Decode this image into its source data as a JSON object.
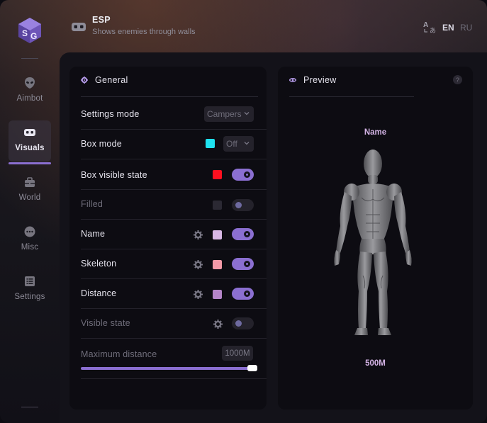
{
  "sidebar": {
    "logo": "sg-cube-logo",
    "items": [
      {
        "label": "Aimbot",
        "icon": "alien-icon"
      },
      {
        "label": "Visuals",
        "icon": "vr-headset-icon",
        "active": true
      },
      {
        "label": "World",
        "icon": "briefcase-icon"
      },
      {
        "label": "Misc",
        "icon": "dots-circle-icon"
      },
      {
        "label": "Settings",
        "icon": "list-icon"
      }
    ]
  },
  "header": {
    "icon": "vr-headset-icon",
    "title": "ESP",
    "subtitle": "Shows enemies through walls",
    "languages": [
      "EN",
      "RU"
    ],
    "active_language": "EN"
  },
  "general": {
    "title": "General",
    "settings_mode": {
      "label": "Settings mode",
      "value": "Campers"
    },
    "box_mode": {
      "label": "Box mode",
      "value": "Off",
      "color": "#1fe2f0"
    },
    "box_visible_state": {
      "label": "Box visible state",
      "color": "#ff1020",
      "enabled": true
    },
    "filled": {
      "label": "Filled",
      "color": "#2b2933",
      "enabled": false
    },
    "name": {
      "label": "Name",
      "color": "#d9b8e6",
      "enabled": true
    },
    "skeleton": {
      "label": "Skeleton",
      "color": "#f39aa8",
      "enabled": true
    },
    "distance": {
      "label": "Distance",
      "color": "#b585c9",
      "enabled": true
    },
    "visible_state": {
      "label": "Visible state",
      "enabled": false
    },
    "max_distance": {
      "label": "Maximum distance",
      "value": "1000M",
      "slider_fraction": 1.0
    }
  },
  "preview": {
    "title": "Preview",
    "help": "?",
    "name_label": "Name",
    "distance_label": "500M"
  },
  "colors": {
    "accent": "#8b6fd1",
    "name_text": "#d4b4e6"
  }
}
